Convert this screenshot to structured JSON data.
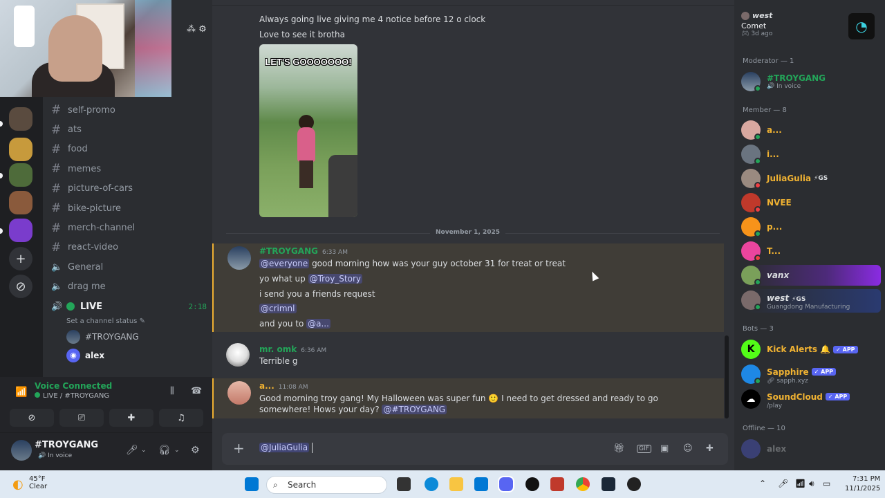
{
  "channels": {
    "text": [
      "self-promo",
      "ats",
      "food",
      "memes",
      "picture-of-cars",
      "bike-picture",
      "merch-channel",
      "react-video"
    ],
    "voice": [
      "General",
      "drag me"
    ],
    "live": {
      "label": "LIVE",
      "time": "2:18",
      "status": "Set a channel status"
    },
    "live_users": [
      "#TROYGANG",
      "alex"
    ]
  },
  "voice_panel": {
    "title": "Voice Connected",
    "subtitle": "LIVE / #TROYGANG"
  },
  "user_panel": {
    "name": "#TROYGANG",
    "status": "In voice"
  },
  "messages": {
    "earlier_lines": [
      "Always going live giving me 4 notice before 12 o clock",
      "Love to see it brotha"
    ],
    "gif_caption": "LET'S GOOOOOOO!",
    "date_divider": "November 1, 2025",
    "m1": {
      "author": "#TROYGANG",
      "time": "6:33 AM",
      "mention_everyone": "@everyone",
      "line1_text": "good morning how was your guy october 31 for treat or treat",
      "line2_text": "yo what up",
      "line2_mention": "@Troy_Story",
      "line3_text": "i send you a friends request",
      "line4_mention": "@crimnl",
      "line5_text": "and you to",
      "line5_mention": "@a..."
    },
    "m2": {
      "author": "mr. omk",
      "time": "6:36 AM",
      "text": "Terrible g"
    },
    "m3": {
      "author": "a...",
      "time": "11:08 AM",
      "text_a": "Good morning troy gang! My Halloween was super fun",
      "emoji": "🙂",
      "text_b": "I need to get dressed and ready to go somewhere! Hows your day?",
      "mention": "@#TROYGANG"
    }
  },
  "composer": {
    "value": "@JuliaGulia"
  },
  "members": {
    "top": {
      "name": "west",
      "activity": "Comet",
      "ago": "3d ago"
    },
    "moderator_header": "Moderator — 1",
    "moderators": [
      {
        "name": "#TROYGANG",
        "sub": "In voice",
        "color": "#23a559"
      }
    ],
    "member_header": "Member — 8",
    "members": [
      {
        "name": "a...",
        "color": "#f0b232"
      },
      {
        "name": "i...",
        "color": "#f0b232"
      },
      {
        "name": "JuliaGulia",
        "tag": "⚡GS",
        "color": "#f0b232"
      },
      {
        "name": "NVEE",
        "color": "#f0b232"
      },
      {
        "name": "p...",
        "color": "#f0b232"
      },
      {
        "name": "T...",
        "color": "#f0b232"
      },
      {
        "name": "vanx",
        "color": "#dbdee1"
      },
      {
        "name": "west",
        "tag": "⚡GS",
        "sub": "Guangdong Manufacturing",
        "color": "#dbdee1"
      }
    ],
    "bots_header": "Bots — 3",
    "bots": [
      {
        "name": "Kick Alerts 🔔",
        "badge": "✓ APP",
        "color": "#f0b232"
      },
      {
        "name": "Sapphire",
        "badge": "✓ APP",
        "sub": "sapph.xyz",
        "color": "#f0b232"
      },
      {
        "name": "SoundCloud",
        "badge": "✓ APP",
        "sub": "/play",
        "color": "#f0b232"
      }
    ],
    "offline_header": "Offline — 10",
    "offline": [
      {
        "name": "alex"
      }
    ]
  },
  "taskbar": {
    "temp": "45°F",
    "weather": "Clear",
    "search": "Search",
    "time": "7:31 PM",
    "date": "11/1/2025"
  }
}
